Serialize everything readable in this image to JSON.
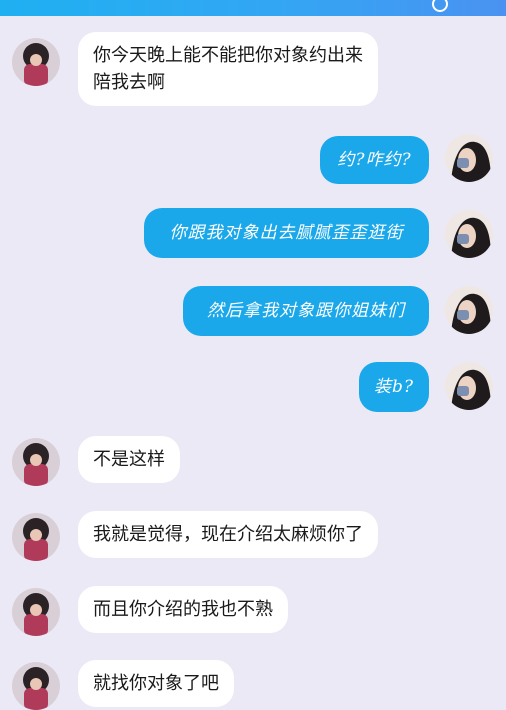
{
  "chat": {
    "messages": [
      {
        "from": "friend",
        "text": "你今天晚上能不能把你对象约出来\n陪我去啊"
      },
      {
        "from": "me",
        "text": "约?咋约?"
      },
      {
        "from": "me",
        "text": "你跟我对象出去腻腻歪歪逛街"
      },
      {
        "from": "me",
        "text": "然后拿我对象跟你姐妹们"
      },
      {
        "from": "me",
        "text": "装b?"
      },
      {
        "from": "friend",
        "text": "不是这样"
      },
      {
        "from": "friend",
        "text": "我就是觉得，现在介绍太麻烦你了"
      },
      {
        "from": "friend",
        "text": "而且你介绍的我也不熟"
      },
      {
        "from": "friend",
        "text": "就找你对象了吧"
      }
    ]
  },
  "colors": {
    "background": "#ece9f7",
    "header": "#33a6f3",
    "sent_bubble": "#1ba8ea",
    "received_bubble": "#ffffff"
  },
  "icons": {
    "friend_avatar": "friend-avatar-photo",
    "my_avatar": "my-avatar-photo"
  }
}
